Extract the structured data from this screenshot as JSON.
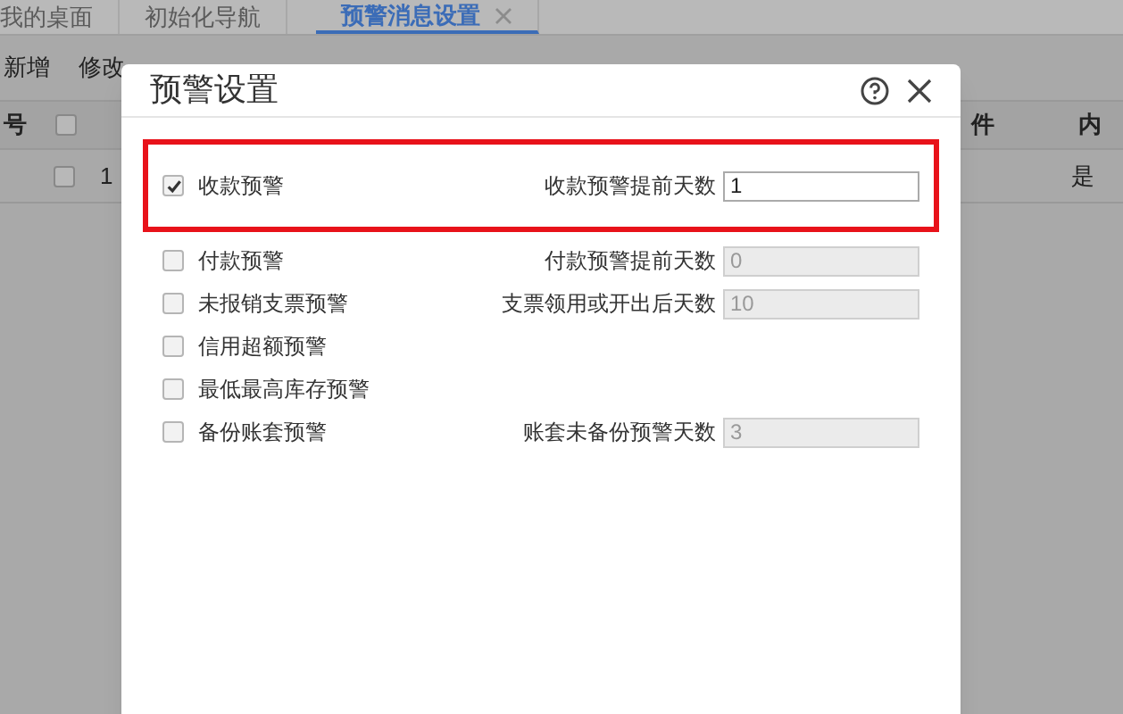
{
  "tabs": [
    {
      "label": "我的桌面",
      "selected": false,
      "closable": false
    },
    {
      "label": "初始化导航",
      "selected": false,
      "closable": false
    },
    {
      "label": "预警消息设置",
      "selected": true,
      "closable": true
    }
  ],
  "toolbar": [
    "新增",
    "修改"
  ],
  "table": {
    "all_checked": false,
    "columns": [
      "号",
      "件",
      "内"
    ],
    "rows": [
      {
        "number": "1",
        "checked": false,
        "column_5": "是"
      }
    ]
  },
  "dialog": {
    "title": "预警设置",
    "options": [
      {
        "label": "收款预警",
        "checked": true,
        "highlighted": true,
        "field": {
          "label": "收款预警提前天数",
          "value": "1",
          "disabled": false
        }
      },
      {
        "label": "付款预警",
        "checked": false,
        "highlighted": false,
        "field": {
          "label": "付款预警提前天数",
          "value": "0",
          "disabled": true
        }
      },
      {
        "label": "未报销支票预警",
        "checked": false,
        "highlighted": false,
        "field": {
          "label": "支票领用或开出后天数",
          "value": "10",
          "disabled": true
        }
      },
      {
        "label": "信用超额预警",
        "checked": false,
        "highlighted": false
      },
      {
        "label": "最低最高库存预警",
        "checked": false,
        "highlighted": false
      },
      {
        "label": "备份账套预警",
        "checked": false,
        "highlighted": false,
        "field": {
          "label": "账套未备份预警天数",
          "value": "3",
          "disabled": true
        }
      }
    ]
  }
}
